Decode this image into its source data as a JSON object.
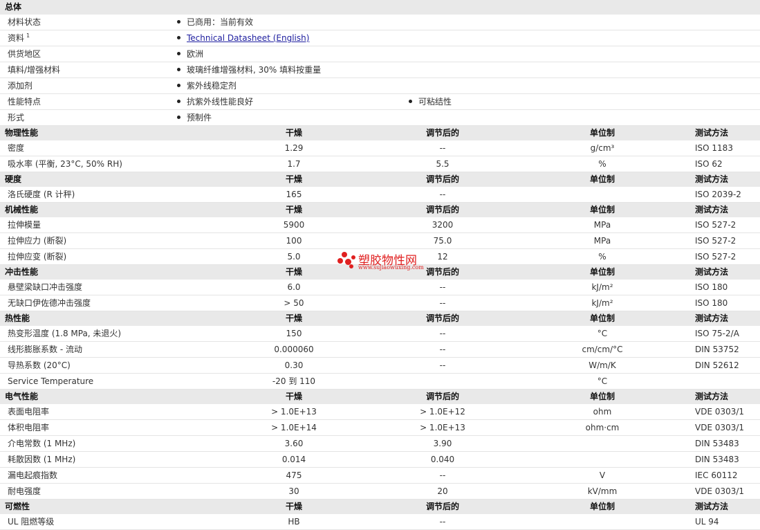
{
  "sections": [
    {
      "id": "general",
      "title": "总体",
      "rows": [
        {
          "label": "材料状态",
          "items": [
            "已商用：当前有效"
          ]
        },
        {
          "label": "资料",
          "sup": "1",
          "items": [
            "Technical Datasheet (English)"
          ],
          "link": true
        },
        {
          "label": "供货地区",
          "items": [
            "欧洲"
          ]
        },
        {
          "label": "填料/增强材料",
          "items": [
            "玻璃纤维增强材料, 30% 填料按重量"
          ]
        },
        {
          "label": "添加剂",
          "items": [
            "紫外线稳定剂"
          ]
        },
        {
          "label": "性能特点",
          "items": [
            "抗紫外线性能良好",
            "可粘结性"
          ]
        },
        {
          "label": "形式",
          "items": [
            "预制件"
          ]
        }
      ]
    },
    {
      "id": "physical",
      "title": "物理性能",
      "h1": "干燥",
      "h2": "调节后的",
      "h3": "单位制",
      "h4": "测试方法",
      "rows": [
        {
          "label": "密度",
          "v1": "1.29",
          "v2": "--",
          "unit": "g/cm³",
          "test": "ISO 1183"
        },
        {
          "label": "吸水率 (平衡, 23°C, 50% RH)",
          "v1": "1.7",
          "v2": "5.5",
          "unit": "%",
          "test": "ISO 62"
        }
      ]
    },
    {
      "id": "hardness",
      "title": "硬度",
      "h1": "干燥",
      "h2": "调节后的",
      "h3": "单位制",
      "h4": "测试方法",
      "rows": [
        {
          "label": "洛氏硬度 (R 计秤)",
          "v1": "165",
          "v2": "--",
          "unit": "",
          "test": "ISO 2039-2"
        }
      ]
    },
    {
      "id": "mechanical",
      "title": "机械性能",
      "h1": "干燥",
      "h2": "调节后的",
      "h3": "单位制",
      "h4": "测试方法",
      "rows": [
        {
          "label": "拉伸模量",
          "v1": "5900",
          "v2": "3200",
          "unit": "MPa",
          "test": "ISO 527-2"
        },
        {
          "label": "拉伸应力 (断裂)",
          "v1": "100",
          "v2": "75.0",
          "unit": "MPa",
          "test": "ISO 527-2"
        },
        {
          "label": "拉伸应变 (断裂)",
          "v1": "5.0",
          "v2": "12",
          "unit": "%",
          "test": "ISO 527-2"
        }
      ]
    },
    {
      "id": "impact",
      "title": "冲击性能",
      "h1": "干燥",
      "h2": "调节后的",
      "h3": "单位制",
      "h4": "测试方法",
      "rows": [
        {
          "label": "悬壁梁缺口冲击强度",
          "v1": "6.0",
          "v2": "--",
          "unit": "kJ/m²",
          "test": "ISO 180"
        },
        {
          "label": "无缺口伊佐德冲击强度",
          "v1": "> 50",
          "v2": "--",
          "unit": "kJ/m²",
          "test": "ISO 180"
        }
      ]
    },
    {
      "id": "thermal",
      "title": "热性能",
      "h1": "干燥",
      "h2": "调节后的",
      "h3": "单位制",
      "h4": "测试方法",
      "rows": [
        {
          "label": "热变形温度 (1.8 MPa, 未退火)",
          "v1": "150",
          "v2": "--",
          "unit": "°C",
          "test": "ISO 75-2/A"
        },
        {
          "label": "线形膨胀系数 - 流动",
          "v1": "0.000060",
          "v2": "--",
          "unit": "cm/cm/°C",
          "test": "DIN 53752"
        },
        {
          "label": "导热系数 (20°C)",
          "v1": "0.30",
          "v2": "--",
          "unit": "W/m/K",
          "test": "DIN 52612"
        },
        {
          "label": "Service Temperature",
          "v1": "-20 到  110",
          "v2": "",
          "unit": "°C",
          "test": ""
        }
      ]
    },
    {
      "id": "electrical",
      "title": "电气性能",
      "h1": "干燥",
      "h2": "调节后的",
      "h3": "单位制",
      "h4": "测试方法",
      "rows": [
        {
          "label": "表面电阻率",
          "v1": "> 1.0E+13",
          "v2": "> 1.0E+12",
          "unit": "ohm",
          "test": "VDE 0303/1"
        },
        {
          "label": "体积电阻率",
          "v1": "> 1.0E+14",
          "v2": "> 1.0E+13",
          "unit": "ohm·cm",
          "test": "VDE 0303/1"
        },
        {
          "label": "介电常数 (1 MHz)",
          "v1": "3.60",
          "v2": "3.90",
          "unit": "",
          "test": "DIN 53483"
        },
        {
          "label": "耗散因数 (1 MHz)",
          "v1": "0.014",
          "v2": "0.040",
          "unit": "",
          "test": "DIN 53483"
        },
        {
          "label": "漏电起痕指数",
          "v1": "475",
          "v2": "--",
          "unit": "V",
          "test": "IEC 60112"
        },
        {
          "label": "耐电强度",
          "v1": "30",
          "v2": "20",
          "unit": "kV/mm",
          "test": "VDE 0303/1"
        }
      ]
    },
    {
      "id": "flammability",
      "title": "可燃性",
      "h1": "干燥",
      "h2": "调节后的",
      "h3": "单位制",
      "h4": "测试方法",
      "rows": [
        {
          "label": "UL 阻燃等级",
          "v1": "HB",
          "v2": "--",
          "unit": "",
          "test": "UL 94"
        }
      ]
    }
  ],
  "watermark": {
    "name": "塑胶物性网",
    "url": "www.sujiaowuxing.com",
    "color": "#e02020"
  }
}
